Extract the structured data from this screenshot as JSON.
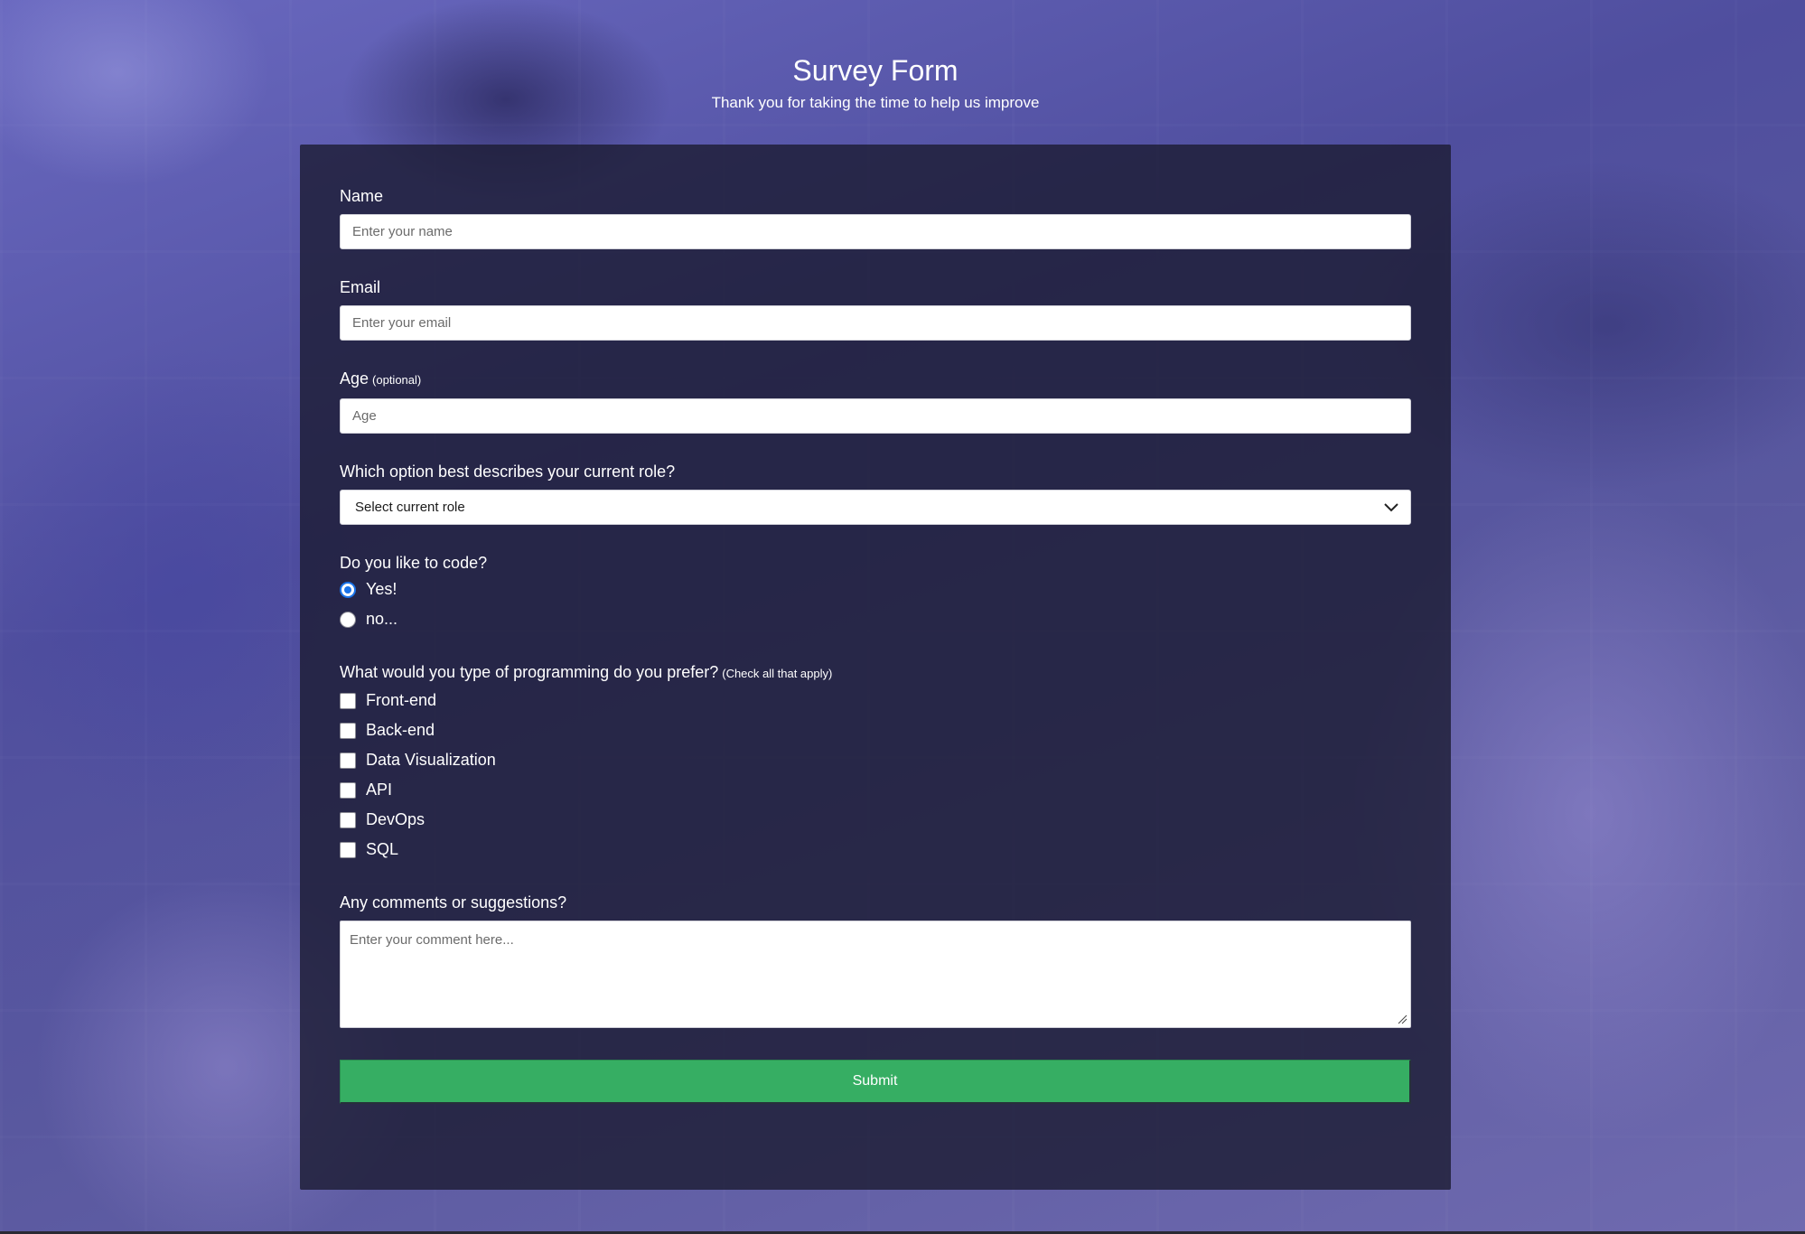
{
  "header": {
    "title": "Survey Form",
    "subtitle": "Thank you for taking the time to help us improve"
  },
  "form": {
    "name": {
      "label": "Name",
      "placeholder": "Enter your name",
      "value": ""
    },
    "email": {
      "label": "Email",
      "placeholder": "Enter your email",
      "value": ""
    },
    "age": {
      "label": "Age",
      "clue": "(optional)",
      "placeholder": "Age",
      "value": ""
    },
    "role": {
      "label": "Which option best describes your current role?",
      "selected": "Select current role",
      "icon": "chevron-down-icon"
    },
    "likes_code": {
      "label": "Do you like to code?",
      "options": [
        {
          "label": "Yes!",
          "checked": true
        },
        {
          "label": "no...",
          "checked": false
        }
      ]
    },
    "preferences": {
      "label": "What would you type of programming do you prefer?",
      "clue": "(Check all that apply)",
      "options": [
        {
          "label": "Front-end",
          "checked": false
        },
        {
          "label": "Back-end",
          "checked": false
        },
        {
          "label": "Data Visualization",
          "checked": false
        },
        {
          "label": "API",
          "checked": false
        },
        {
          "label": "DevOps",
          "checked": false
        },
        {
          "label": "SQL",
          "checked": false
        }
      ]
    },
    "comments": {
      "label": "Any comments or suggestions?",
      "placeholder": "Enter your comment here...",
      "value": ""
    },
    "submit_label": "Submit"
  },
  "colors": {
    "card_background": "#1b1b32",
    "submit_button": "#36ae63",
    "radio_accent": "#1a73e8",
    "page_tint": "#5b5aa8"
  }
}
